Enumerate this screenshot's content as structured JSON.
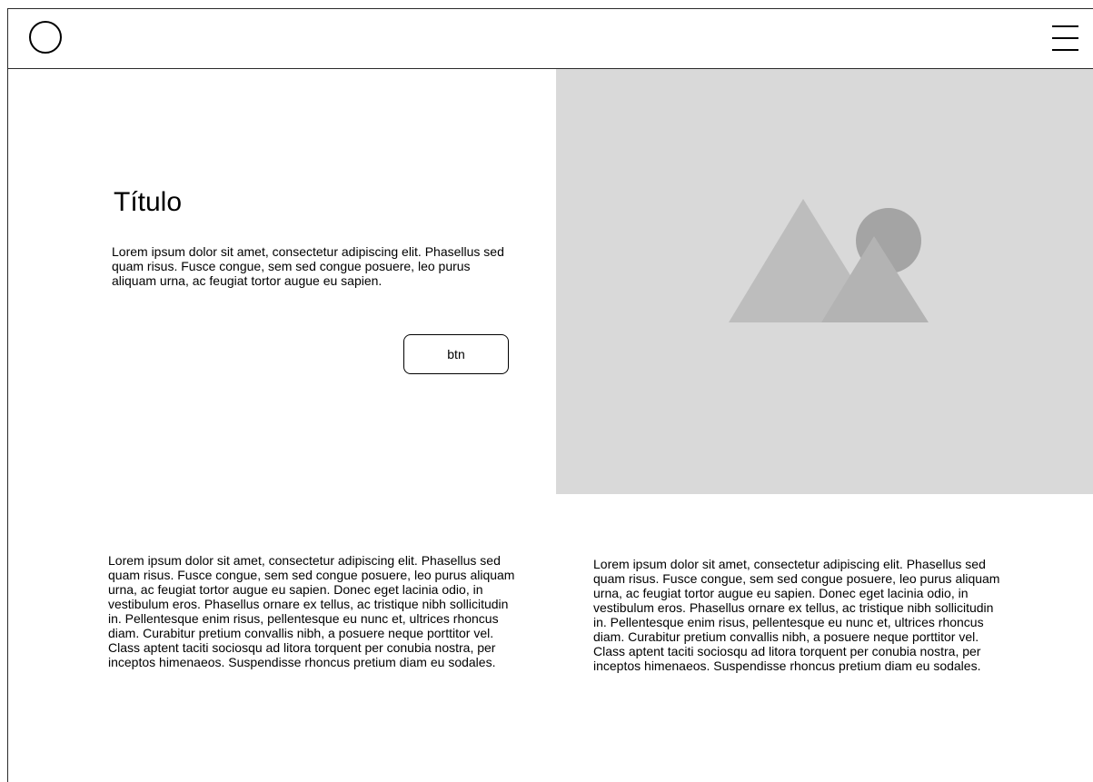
{
  "header": {
    "logo_icon": "circle-logo-icon",
    "menu_icon": "hamburger-menu-icon"
  },
  "hero": {
    "title": "Título",
    "text": "Lorem ipsum dolor sit amet, consectetur adipiscing elit. Phasellus sed quam risus. Fusce congue, sem sed congue posuere, leo purus aliquam urna, ac feugiat tortor augue eu sapien.",
    "button_label": "btn",
    "image_icon": "image-placeholder-icon"
  },
  "columns": [
    {
      "text": "Lorem ipsum dolor sit amet, consectetur adipiscing elit. Phasellus sed quam risus. Fusce congue, sem sed congue posuere, leo purus aliquam urna, ac feugiat tortor augue eu sapien. Donec eget lacinia odio, in vestibulum eros. Phasellus ornare ex tellus, ac tristique nibh sollicitudin in. Pellentesque enim risus, pellentesque eu nunc et, ultrices rhoncus diam. Curabitur pretium convallis nibh, a posuere neque porttitor vel. Class aptent taciti sociosqu ad litora torquent per conubia nostra, per inceptos himenaeos. Suspendisse rhoncus pretium diam eu sodales."
    },
    {
      "text": "Lorem ipsum dolor sit amet, consectetur adipiscing elit. Phasellus sed quam risus. Fusce congue, sem sed congue posuere, leo purus aliquam urna, ac feugiat tortor augue eu sapien. Donec eget lacinia odio, in vestibulum eros. Phasellus ornare ex tellus, ac tristique nibh sollicitudin in. Pellentesque enim risus, pellentesque eu nunc et, ultrices rhoncus diam. Curabitur pretium convallis nibh, a posuere neque porttitor vel. Class aptent taciti sociosqu ad litora torquent per conubia nostra, per inceptos himenaeos. Suspendisse rhoncus pretium diam eu sodales."
    }
  ],
  "colors": {
    "background": "#ffffff",
    "border": "#2b2b2b",
    "placeholder_fill": "#d9d9d9",
    "mountain_large": "#bdbdbd",
    "mountain_small": "#b3b3b3",
    "sun": "#a4a4a4"
  }
}
